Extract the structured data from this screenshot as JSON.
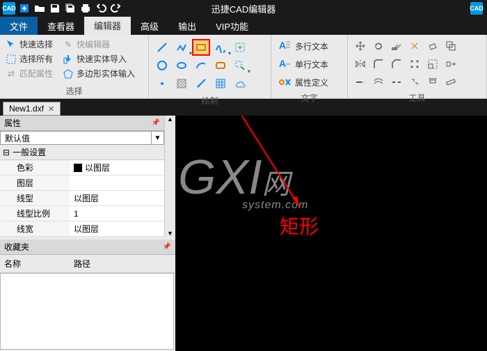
{
  "titlebar": {
    "app_title": "迅捷CAD编辑器",
    "badge": "CAD"
  },
  "menus": {
    "file": "文件",
    "viewer": "查看器",
    "editor": "编辑器",
    "advanced": "高级",
    "output": "输出",
    "vip": "VIP功能"
  },
  "ribbon": {
    "select": {
      "quick_select": "快速选择",
      "select_all": "选择所有",
      "match_prop": "匹配属性",
      "quick_editor": "快编辑器",
      "quick_import": "快速实体导入",
      "polygon_input": "多边形实体输入",
      "label": "选择"
    },
    "draw": {
      "label": "绘制"
    },
    "text": {
      "multiline": "多行文本",
      "singleline": "单行文本",
      "attr_def": "属性定义",
      "label": "文字"
    },
    "tools": {
      "label": "工具"
    }
  },
  "doc": {
    "tab1": "New1.dxf"
  },
  "props": {
    "title": "属性",
    "default_value": "默认值",
    "section_general": "一般设置",
    "color_k": "色彩",
    "color_v": "以图层",
    "layer_k": "图层",
    "linetype_k": "线型",
    "linetype_v": "以图层",
    "linescale_k": "线型比例",
    "linescale_v": "1",
    "lineweight_k": "线宽",
    "lineweight_v": "以图层"
  },
  "fav": {
    "title": "收藏夹",
    "col_name": "名称",
    "col_path": "路径"
  },
  "watermark": {
    "gx": "GXI",
    "net": "网",
    "sys": "system.com"
  },
  "annotation": {
    "label": "矩形"
  }
}
